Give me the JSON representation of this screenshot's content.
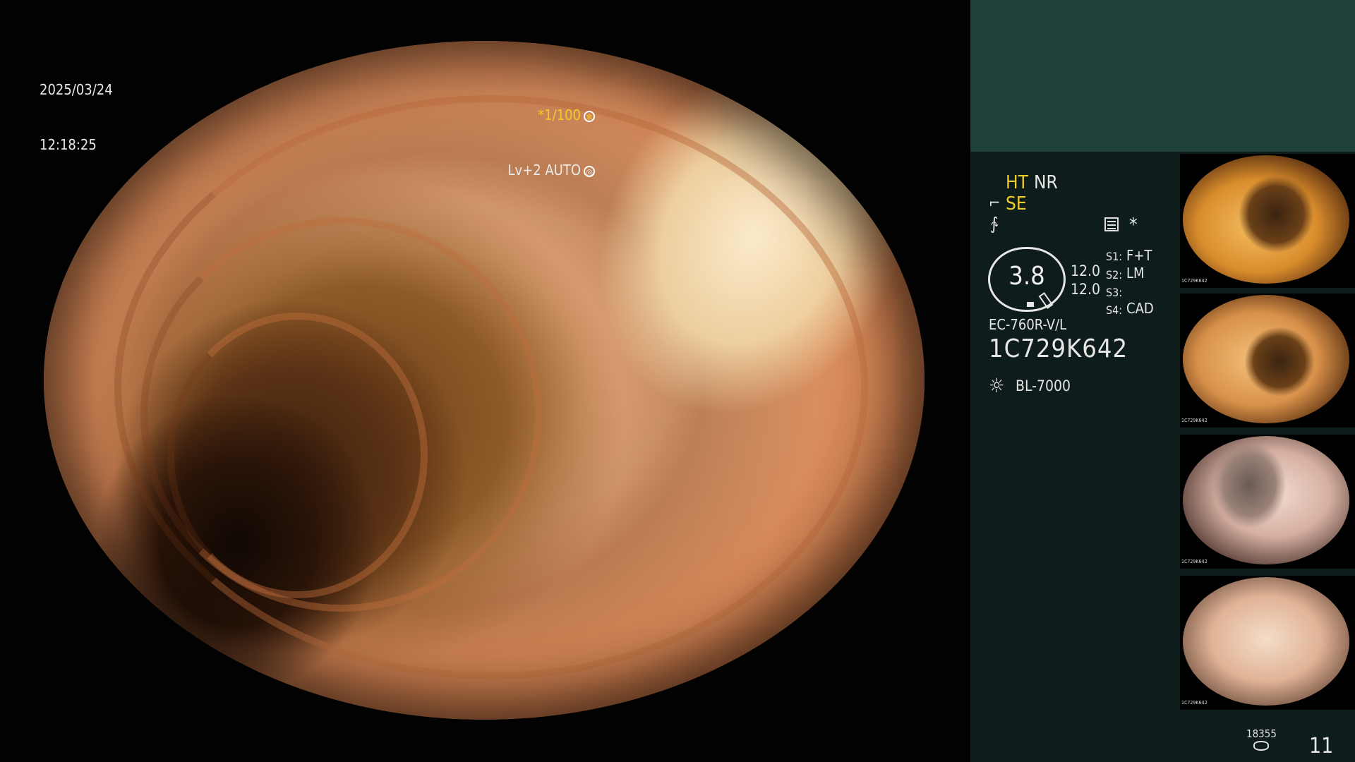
{
  "main": {
    "date": "2025/03/24",
    "time": "12:18:25",
    "shutter": "*1/100",
    "shutter_icon": "aperture-icon",
    "level": "Lv+2 AUTO",
    "level_icon": "iris-icon"
  },
  "panel": {
    "ht": "HT",
    "nr": "NR",
    "se_icon": "air-water-icon",
    "se": "SE",
    "freeze_icon": "freeze-icon",
    "menu_icon": "list-icon",
    "asterisk": "*",
    "gauge_value": "3.8",
    "value_1": "12.0",
    "value_2": "12.0",
    "switches": [
      {
        "label": "S1:",
        "value": "F+T"
      },
      {
        "label": "S2:",
        "value": "LM"
      },
      {
        "label": "S3:",
        "value": ""
      },
      {
        "label": "S4:",
        "value": "CAD"
      }
    ],
    "scope_model": "EC-760R-V/L",
    "scope_serial": "1C729K642",
    "light_icon": "light-source-icon",
    "light_source": "BL-7000",
    "image_count_small": "18355",
    "image_count_big": "11",
    "storage_icon": "database-icon"
  },
  "thumbnails": [
    {
      "serial": "1C729K642"
    },
    {
      "serial": "1C729K642"
    },
    {
      "serial": "1C729K642"
    },
    {
      "serial": "1C729K642"
    }
  ],
  "colors": {
    "accent_yellow": "#f0cc2a",
    "panel_bg": "#0e1d1b",
    "panel_top_bg": "#1f3f3a"
  }
}
